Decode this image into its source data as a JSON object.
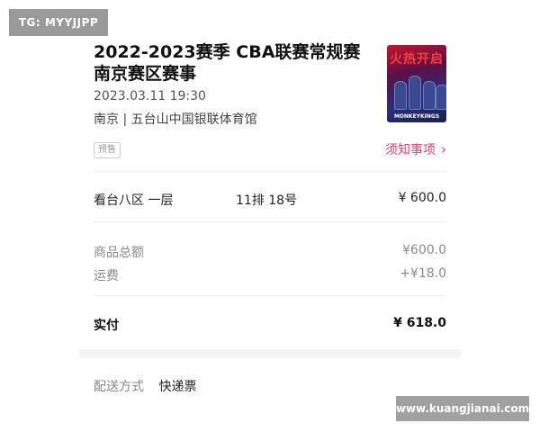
{
  "watermark_top": "TG: MYYJJPP",
  "watermark_bottom": "www.kuangjianai.com",
  "event": {
    "title": "2022-2023赛季 CBA联赛常规赛南京赛区赛事",
    "datetime": "2023.03.11 19:30",
    "venue": "南京 | 五台山中国银联体育馆",
    "badge": "预售",
    "notice_label": "须知事项",
    "poster": {
      "title_text": "火热开启",
      "logo_text": "MONKEYKINGS"
    }
  },
  "ticket": {
    "area": "看台八区 一层",
    "seat": "11排 18号",
    "price": "¥ 600.0"
  },
  "summary": {
    "goods_total_label": "商品总额",
    "goods_total_value": "¥600.0",
    "shipping_label": "运费",
    "shipping_value": "+¥18.0",
    "paid_label": "实付",
    "paid_value": "¥ 618.0"
  },
  "delivery": {
    "label": "配送方式",
    "value": "快递票"
  },
  "colors": {
    "accent": "#d6457d",
    "muted_text": "#8a8a8a",
    "divider": "#eeeeee"
  }
}
